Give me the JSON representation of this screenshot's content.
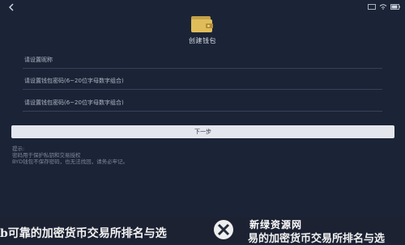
{
  "header": {
    "back_icon": "chevron-left-icon",
    "title": "创建钱包"
  },
  "status_bar": {
    "icons": [
      "cast-icon",
      "wifi-icon",
      "battery-icon"
    ]
  },
  "form": {
    "wallet_name_placeholder": "请设置昵称",
    "password_placeholder": "请设置钱包密码(6~20位字母数字组合)",
    "confirm_password_placeholder": "请设置钱包密码(6~20位字母数字组合)"
  },
  "next_button_label": "下一步",
  "tips": {
    "line1": "提示:",
    "line2": "密码用于保护私钥和交易授权",
    "line3": "BYD钱包不保存密码，也无法找回，请务必牢记。"
  },
  "banner": {
    "left_text": "b可靠的加密货币交易所排名与选",
    "logo_top": "新绿资源网",
    "logo_bottom": "易的加密货币交易所排名与选"
  },
  "colors": {
    "background": "#1b2436",
    "button_bg": "#e3e6ec",
    "divider": "#36405a"
  }
}
